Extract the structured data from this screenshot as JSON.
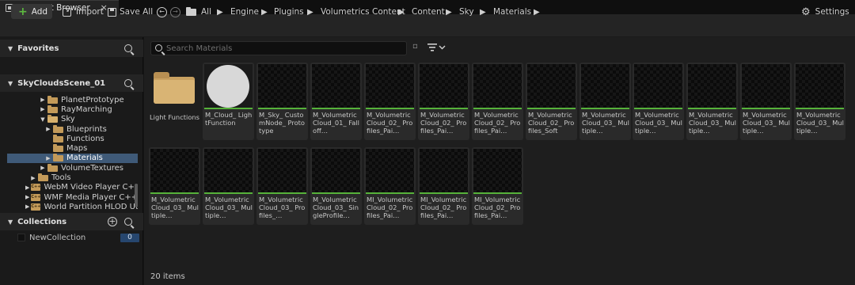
{
  "tab": {
    "title": "Content Browser",
    "close": "×"
  },
  "toolbar": {
    "add_label": "Add",
    "import_label": "Import",
    "save_all_label": "Save All",
    "settings_label": "Settings"
  },
  "breadcrumb": [
    "All",
    "Engine",
    "Plugins",
    "Volumetrics Content",
    "Content",
    "Sky",
    "Materials"
  ],
  "favorites": {
    "title": "Favorites"
  },
  "sources": {
    "title": "SkyCloudsScene_01",
    "tree": [
      {
        "label": "PlanetPrototype",
        "arrow": "▶"
      },
      {
        "label": "RayMarching",
        "arrow": "▶"
      },
      {
        "label": "Sky",
        "arrow": "▼"
      },
      {
        "label": "Blueprints",
        "arrow": "▶"
      },
      {
        "label": "Functions",
        "arrow": ""
      },
      {
        "label": "Maps",
        "arrow": ""
      },
      {
        "label": "Materials",
        "arrow": "▶"
      },
      {
        "label": "VolumeTextures",
        "arrow": "▶"
      },
      {
        "label": "Tools",
        "arrow": "▶"
      },
      {
        "label": "WebM Video Player C++",
        "arrow": "▶"
      },
      {
        "label": "WMF Media Player C++",
        "arrow": "▶"
      },
      {
        "label": "World Partition HLOD Ut",
        "arrow": "▶"
      }
    ],
    "plugin_badge": "C++"
  },
  "collections": {
    "title": "Collections",
    "item": "NewCollection",
    "count": "0"
  },
  "search": {
    "placeholder": "Search Materials"
  },
  "assets": [
    "Light Functions",
    "M_Cloud_ LightFunction",
    "M_Sky_ CustomNode_ Prototype",
    "M_Volumetric Cloud_01_ Falloff…",
    "M_Volumetric Cloud_02_ Profiles_Pai…",
    "M_Volumetric Cloud_02_ Profiles_Pai…",
    "M_Volumetric Cloud_02_ Profiles_Pai…",
    "M_Volumetric Cloud_02_ Profiles_Soft",
    "M_Volumetric Cloud_03_ Multiple…",
    "M_Volumetric Cloud_03_ Multiple…",
    "M_Volumetric Cloud_03_ Multiple…",
    "M_Volumetric Cloud_03_ Multiple…",
    "M_Volumetric Cloud_03_ Multiple…",
    "M_Volumetric Cloud_03_ Multiple…",
    "M_Volumetric Cloud_03_ Multiple…",
    "M_Volumetric Cloud_03_ Profiles_…",
    "M_Volumetric Cloud_03_ SingleProfile…",
    "MI_Volumetric Cloud_02_ Profiles_Pai…",
    "MI_Volumetric Cloud_02_ Profiles_Pai…",
    "MI_Volumetric Cloud_02_ Profiles_Pai…"
  ],
  "status": {
    "items": "20 items"
  },
  "colors": {
    "accent_green": "#56b23a",
    "selection": "#3f5a78",
    "folder": "#c39a59"
  }
}
